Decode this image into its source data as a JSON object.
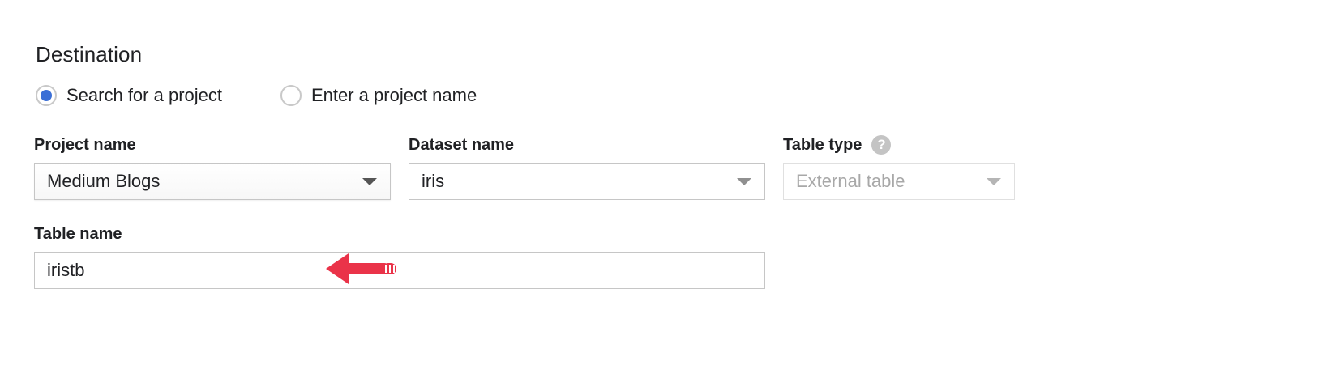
{
  "destination": {
    "title": "Destination",
    "options": [
      {
        "label": "Search for a project",
        "selected": true
      },
      {
        "label": "Enter a project name",
        "selected": false
      }
    ]
  },
  "project": {
    "label": "Project name",
    "value": "Medium Blogs"
  },
  "dataset": {
    "label": "Dataset name",
    "value": "iris"
  },
  "table_type": {
    "label": "Table type",
    "help_glyph": "?",
    "value": "External table",
    "disabled": true
  },
  "table_name": {
    "label": "Table name",
    "value": "iristb"
  },
  "colors": {
    "radio_selected": "#3b6fd6",
    "annotation_arrow": "#ea3349",
    "help_icon": "#c4c4c4"
  },
  "icons": {
    "dropdown": "chevron-down-icon",
    "help": "help-icon",
    "annotation": "arrow-left-icon"
  }
}
